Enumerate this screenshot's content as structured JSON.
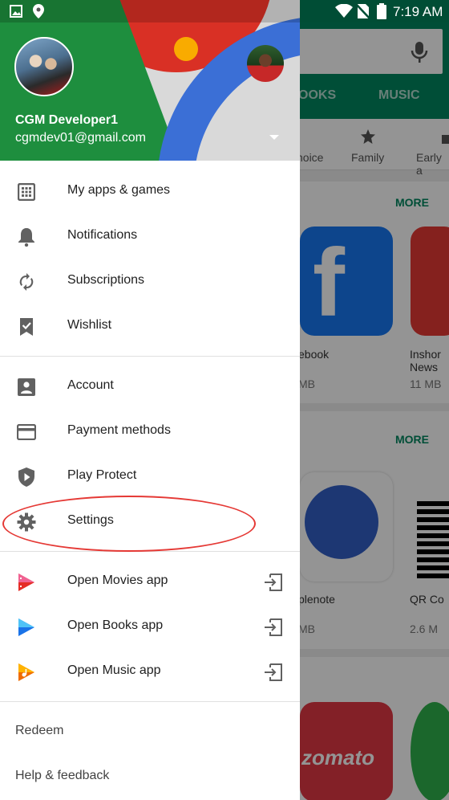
{
  "status_bar": {
    "time": "7:19 AM"
  },
  "drawer": {
    "account": {
      "name": "CGM Developer1",
      "email": "cgmdev01@gmail.com"
    },
    "groups": [
      [
        {
          "label": "My apps & games",
          "icon": "apps-grid-icon"
        },
        {
          "label": "Notifications",
          "icon": "bell-icon"
        },
        {
          "label": "Subscriptions",
          "icon": "refresh-icon"
        },
        {
          "label": "Wishlist",
          "icon": "bookmark-check-icon"
        }
      ],
      [
        {
          "label": "Account",
          "icon": "person-icon"
        },
        {
          "label": "Payment methods",
          "icon": "credit-card-icon"
        },
        {
          "label": "Play Protect",
          "icon": "shield-play-icon"
        },
        {
          "label": "Settings",
          "icon": "gear-icon"
        }
      ],
      [
        {
          "label": "Open Movies app",
          "icon": "play-movies-icon"
        },
        {
          "label": "Open Books app",
          "icon": "play-books-icon"
        },
        {
          "label": "Open Music app",
          "icon": "play-music-icon"
        }
      ],
      [
        {
          "label": "Redeem"
        },
        {
          "label": "Help & feedback"
        }
      ]
    ]
  },
  "background": {
    "tabs": [
      "OOKS",
      "MUSIC"
    ],
    "chips": [
      "hoice",
      "Family",
      "Early a"
    ],
    "more_label": "MORE",
    "apps": [
      {
        "name": "ebook",
        "size": "MB"
      },
      {
        "name": "Inshor News",
        "size": "11 MB"
      },
      {
        "name": "plenote",
        "size": "MB"
      },
      {
        "name": "QR Co",
        "size": "2.6 M"
      }
    ],
    "tile_texts": [
      "f",
      "zomato"
    ]
  },
  "colors": {
    "accent_green": "#01875f",
    "highlight": "#e53935"
  }
}
